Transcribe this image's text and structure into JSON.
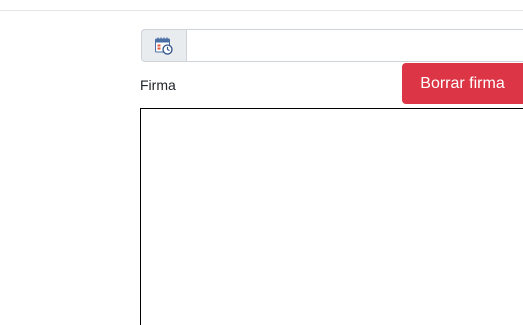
{
  "datetime": {
    "icon": "calendar-clock-icon",
    "value": "",
    "placeholder": ""
  },
  "signature": {
    "label": "Firma",
    "clear_button": "Borrar firma"
  },
  "colors": {
    "danger": "#dc3545",
    "addon_bg": "#e9ecef",
    "border": "#ced4da"
  }
}
